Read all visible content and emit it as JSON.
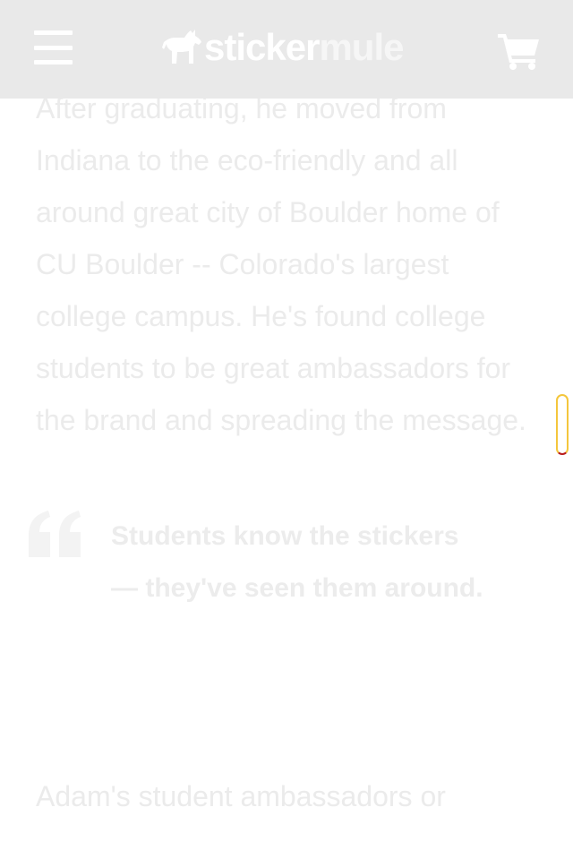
{
  "header": {
    "brand_word1": "sticker",
    "brand_word2": "mule",
    "menu_icon": "hamburger-menu-icon",
    "logo_icon": "mule-logo-icon",
    "cart_icon": "shopping-cart-icon",
    "background": "#e9e9e9"
  },
  "article": {
    "paragraph1": "After graduating, he moved from Indiana to the eco-friendly and all around great city of Boulder home of CU Boulder -- Colorado's largest college campus. He's found college students to be great ambassadors for the brand and spreading the message.",
    "quote": "Students know the stickers — they've seen them around.",
    "quote_icon": "quotation-mark-icon",
    "paragraph2": "Adam's student ambassadors or"
  },
  "colors": {
    "text_faded": "#ebebeb",
    "scrollbar_top": "#f4c63c",
    "scrollbar_bottom": "#b81a1a"
  }
}
